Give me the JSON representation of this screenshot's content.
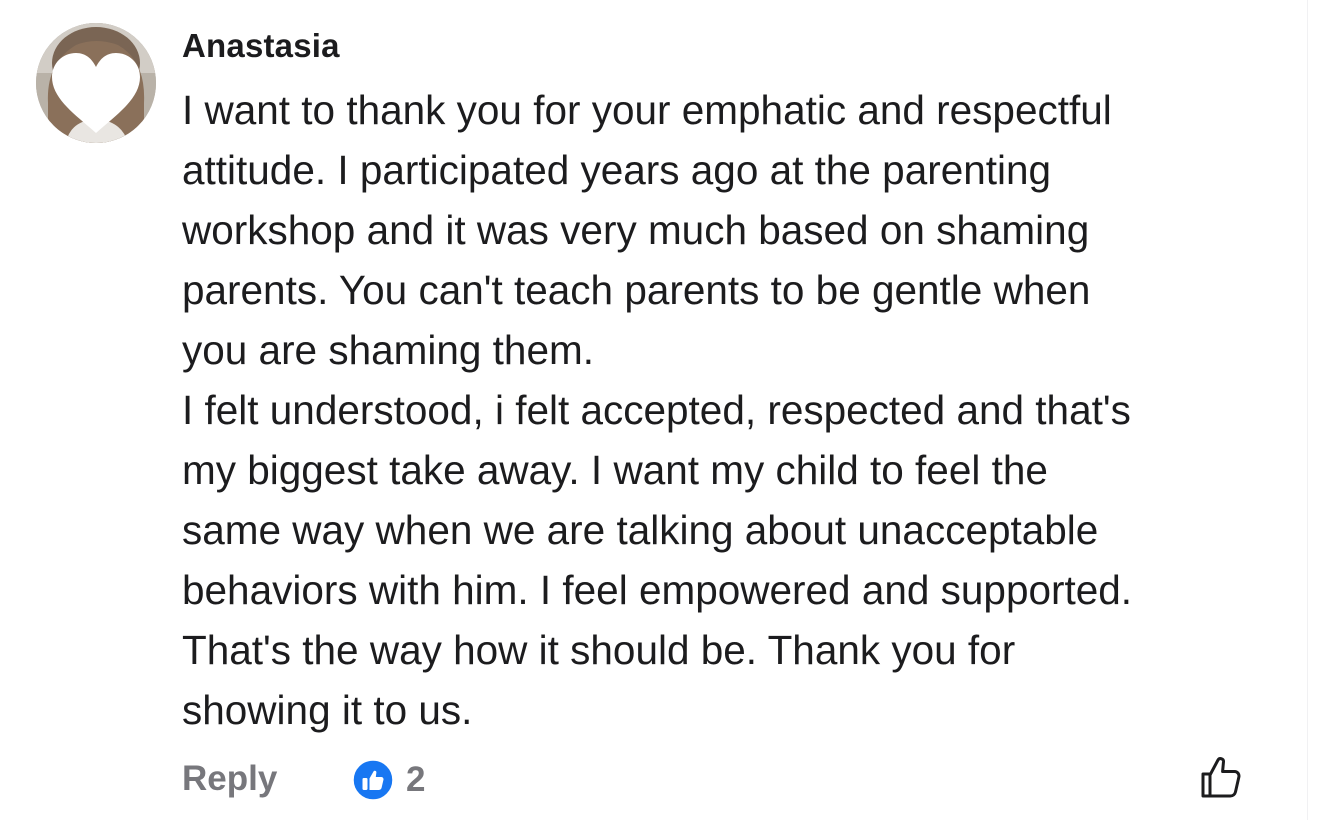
{
  "comment": {
    "author": "Anastasia",
    "lines": [
      "I want to thank you for your emphatic and respectful",
      "attitude. I participated years ago at the parenting",
      "workshop and it was very much based on shaming",
      "parents. You can't teach parents to be gentle when",
      "you are shaming them.",
      "I felt understood, i felt accepted, respected and that's",
      "my biggest take away. I want my child to feel the",
      "same way when we are talking about unacceptable",
      "behaviors with him. I feel empowered and supported.",
      "That's the way how it should be. Thank you for",
      "showing it to us."
    ]
  },
  "actions": {
    "reply_label": "Reply",
    "reaction_count": "2",
    "reaction_icon": "like-reaction-icon",
    "like_icon": "thumbs-up-outline-icon"
  },
  "colors": {
    "text": "#1c1c1e",
    "muted": "#77777c",
    "reaction_blue": "#1877f2"
  }
}
